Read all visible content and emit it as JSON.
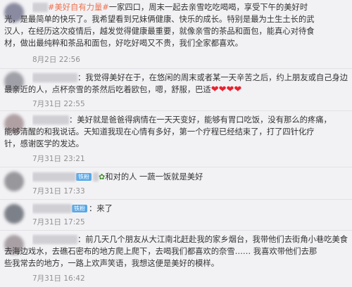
{
  "comments": [
    {
      "hashtag": "#美好自有力量#",
      "lines": [
        "一家四口，周末一起去亲雪吃吃喝喝，享受下午的美好时",
        "光，是最简单的快乐了。我希望看到兄妹俩健康、快乐的成长。特别是最为土生土长的武",
        "汉人，在经历这次疫情后，越发觉得健康最重要，就像亲雪的茶品和面包，能真心对待食",
        "材，做出最纯粹和茶品和面包，好吃好喝又不贵，我们全家都喜欢。"
      ],
      "time": "8月2日 22:56"
    },
    {
      "lines": [
        "：我觉得美好在于，在悠闲的周末或者某一天辛苦之后，约上朋友或自己身边",
        "最亲近的人，点杯奈雪的茶然后吃着欧包，嗯，舒服，巴适"
      ],
      "hearts": "❤❤❤❤",
      "time": "7月31日 22:55"
    },
    {
      "lines": [
        "：美好就是爸爸得病情在一天天变好，能够有胃口吃饭，没有那么的疼痛，",
        "能够清醒的和我说话。天知道我现在心情有多好，第一个疗程已经结束了，打了四针化疗",
        "针，感谢医学的发达。"
      ],
      "time": "7月31日 23:21"
    },
    {
      "badge": "铁粉",
      "leaf": "✿",
      "text": "和对的人 一蔬一饭就是美好",
      "time": "7月31日 17:33"
    },
    {
      "badge": "铁粉",
      "text": "：来了",
      "time": "7月31日 17:25"
    },
    {
      "lines": [
        "：前几天几个朋友从大江南北赶赴我的家乡烟台，我带他们去街角小巷吃美食，",
        "去海边戏水，去礁石密布的地方爬上爬下，去喝我们都喜欢的奈雪…… 我喜欢带他们去那",
        "些我常去的地方，一路上欢声笑语，我想这便是美好的模样。"
      ],
      "time": "7月31日 16:42"
    }
  ],
  "colors": {
    "accent": "#eb7350",
    "badge": "#56a8e8",
    "heart": "#e8232f",
    "timestamp": "#909090"
  }
}
